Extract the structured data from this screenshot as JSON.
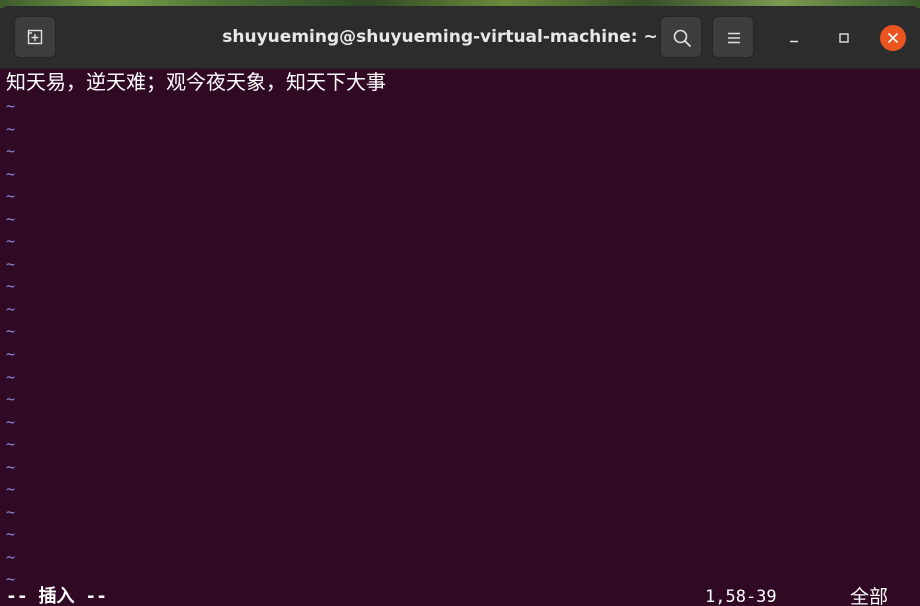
{
  "window": {
    "title": "shuyueming@shuyueming-virtual-machine: ~"
  },
  "icons": {
    "new_tab": "new-tab-icon",
    "search": "search-icon",
    "menu": "hamburger-menu-icon",
    "minimize": "minimize-icon",
    "maximize": "maximize-icon",
    "close": "close-icon"
  },
  "colors": {
    "terminal_bg": "#300a24",
    "titlebar_bg": "#2c2c2c",
    "close_button": "#e95420",
    "tilde": "#8b8bd8"
  },
  "editor": {
    "lines": [
      "知天易，逆天难；观今夜天象，知天下大事"
    ],
    "tilde_char": "~",
    "tilde_count": 22,
    "status": {
      "mode": "-- 插入 --",
      "position": "1,58-39",
      "percent": "全部"
    }
  }
}
